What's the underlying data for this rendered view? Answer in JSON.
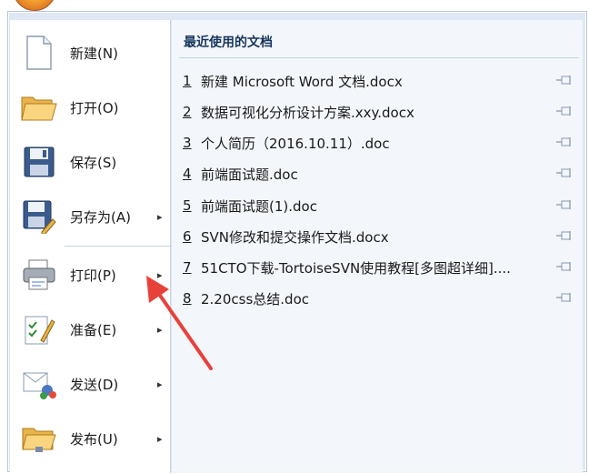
{
  "menu": {
    "items": [
      {
        "label": "新建(N)",
        "icon": "new-document-icon",
        "has_submenu": false
      },
      {
        "label": "打开(O)",
        "icon": "open-folder-icon",
        "has_submenu": false
      },
      {
        "label": "保存(S)",
        "icon": "floppy-disk-icon",
        "has_submenu": false
      },
      {
        "label": "另存为(A)",
        "icon": "save-as-icon",
        "has_submenu": true
      },
      {
        "label": "打印(P)",
        "icon": "printer-icon",
        "has_submenu": true
      },
      {
        "label": "准备(E)",
        "icon": "prepare-icon",
        "has_submenu": true
      },
      {
        "label": "发送(D)",
        "icon": "send-icon",
        "has_submenu": true
      },
      {
        "label": "发布(U)",
        "icon": "publish-folder-icon",
        "has_submenu": true
      }
    ],
    "submenu_arrow": "▸"
  },
  "recent": {
    "title": "最近使用的文档",
    "documents": [
      {
        "num": "1",
        "name": "新建 Microsoft Word 文档.docx"
      },
      {
        "num": "2",
        "name": "数据可视化分析设计方案.xxy.docx"
      },
      {
        "num": "3",
        "name": "个人简历（2016.10.11）.doc"
      },
      {
        "num": "4",
        "name": "前端面试题.doc"
      },
      {
        "num": "5",
        "name": "前端面试题(1).doc"
      },
      {
        "num": "6",
        "name": "SVN修改和提交操作文档.docx"
      },
      {
        "num": "7",
        "name": "51CTO下载-TortoiseSVN使用教程[多图超详细]...."
      },
      {
        "num": "8",
        "name": "2.20css总结.doc"
      }
    ]
  },
  "colors": {
    "annotation_arrow": "#e8413a",
    "panel_bg": "#f3f6fb",
    "frame_bg": "#dfe8f4"
  }
}
